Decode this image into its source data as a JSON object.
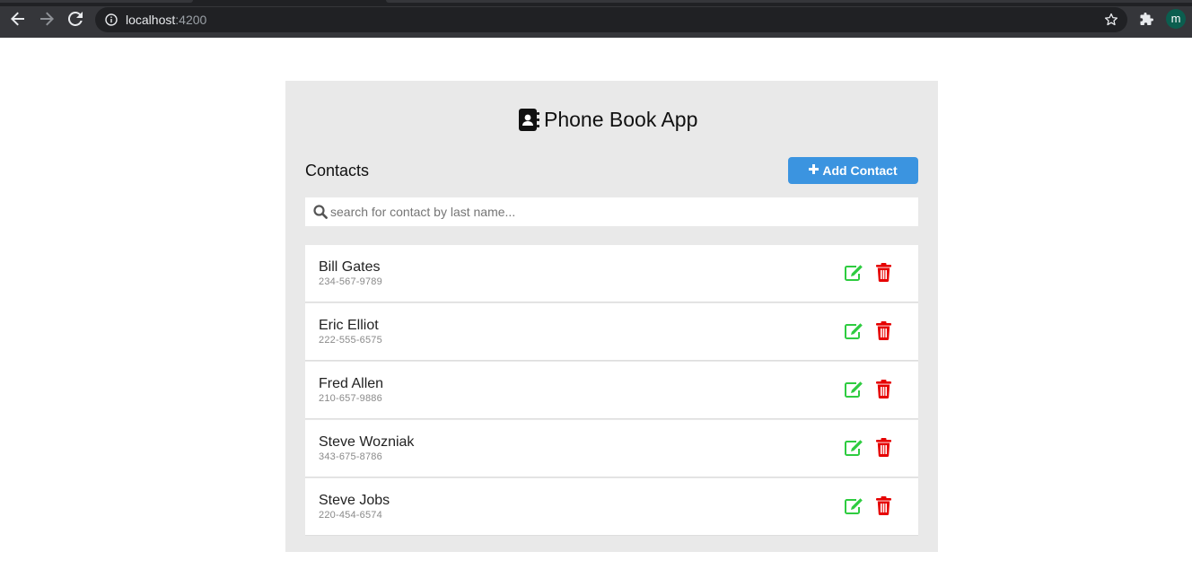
{
  "browser": {
    "url_host": "localhost",
    "url_port": ":4200",
    "profile_initial": "m"
  },
  "app": {
    "title": "Phone Book App",
    "contacts_heading": "Contacts",
    "add_button_label": "Add Contact",
    "search_placeholder": "search for contact by last name...",
    "colors": {
      "accent": "#3b94e0",
      "edit": "#2ecc40",
      "delete": "#e60000",
      "card_background": "#e9e9e9"
    },
    "contacts": [
      {
        "name": "Bill Gates",
        "phone": "234-567-9789"
      },
      {
        "name": "Eric Elliot",
        "phone": "222-555-6575"
      },
      {
        "name": "Fred Allen",
        "phone": "210-657-9886"
      },
      {
        "name": "Steve Wozniak",
        "phone": "343-675-8786"
      },
      {
        "name": "Steve Jobs",
        "phone": "220-454-6574"
      }
    ]
  }
}
